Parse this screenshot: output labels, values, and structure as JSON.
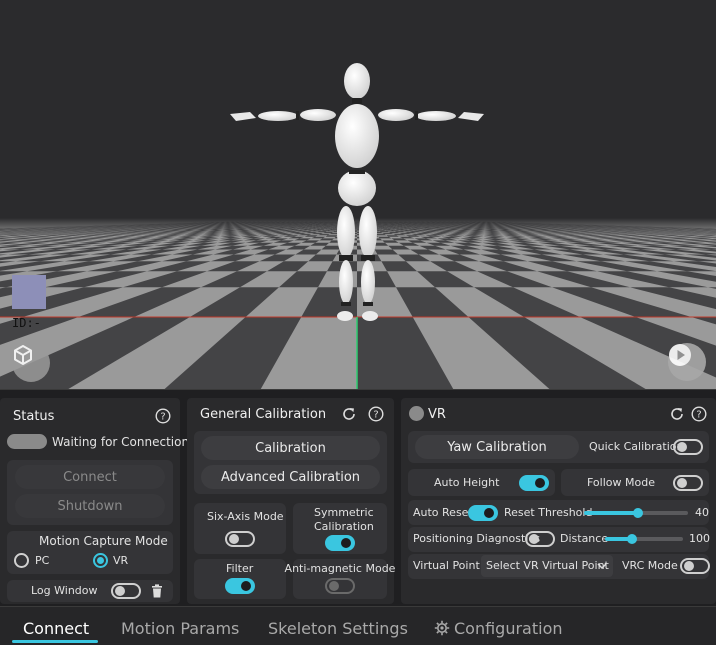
{
  "viewport": {
    "tracker_id": "ID:-"
  },
  "status_panel": {
    "title": "Status",
    "connection_status": "Waiting for Connection",
    "connect_label": "Connect",
    "shutdown_label": "Shutdown",
    "mode_title": "Motion Capture Mode",
    "mode_options": [
      "PC",
      "VR"
    ],
    "mode_selected": "VR",
    "log_window_label": "Log Window"
  },
  "calibration_panel": {
    "title": "General Calibration",
    "calibration_label": "Calibration",
    "advanced_label": "Advanced Calibration",
    "six_axis_label": "Six-Axis Mode",
    "symmetric_label_1": "Symmetric",
    "symmetric_label_2": "Calibration",
    "filter_label": "Filter",
    "anti_magnetic_label": "Anti-magnetic Mode"
  },
  "vr_panel": {
    "title": "VR",
    "yaw_calibration_label": "Yaw Calibration",
    "quick_calibration_label": "Quick Calibration",
    "auto_height_label": "Auto Height",
    "follow_mode_label": "Follow Mode",
    "auto_reset_label": "Auto Reset",
    "reset_threshold_label": "Reset Threshold",
    "reset_threshold_value": "40",
    "positioning_label": "Positioning Diagnostics",
    "distance_label": "Distance",
    "distance_value": "100",
    "virtual_point_label": "Virtual Point",
    "virtual_point_select": "Select VR Virtual Point",
    "vrc_mode_label": "VRC Mode"
  },
  "tabs": [
    "Connect",
    "Motion Params",
    "Skeleton Settings",
    "Configuration"
  ],
  "colors": {
    "accent": "#3ac6e0",
    "panel": "#2a2a2c",
    "card": "#343437"
  }
}
